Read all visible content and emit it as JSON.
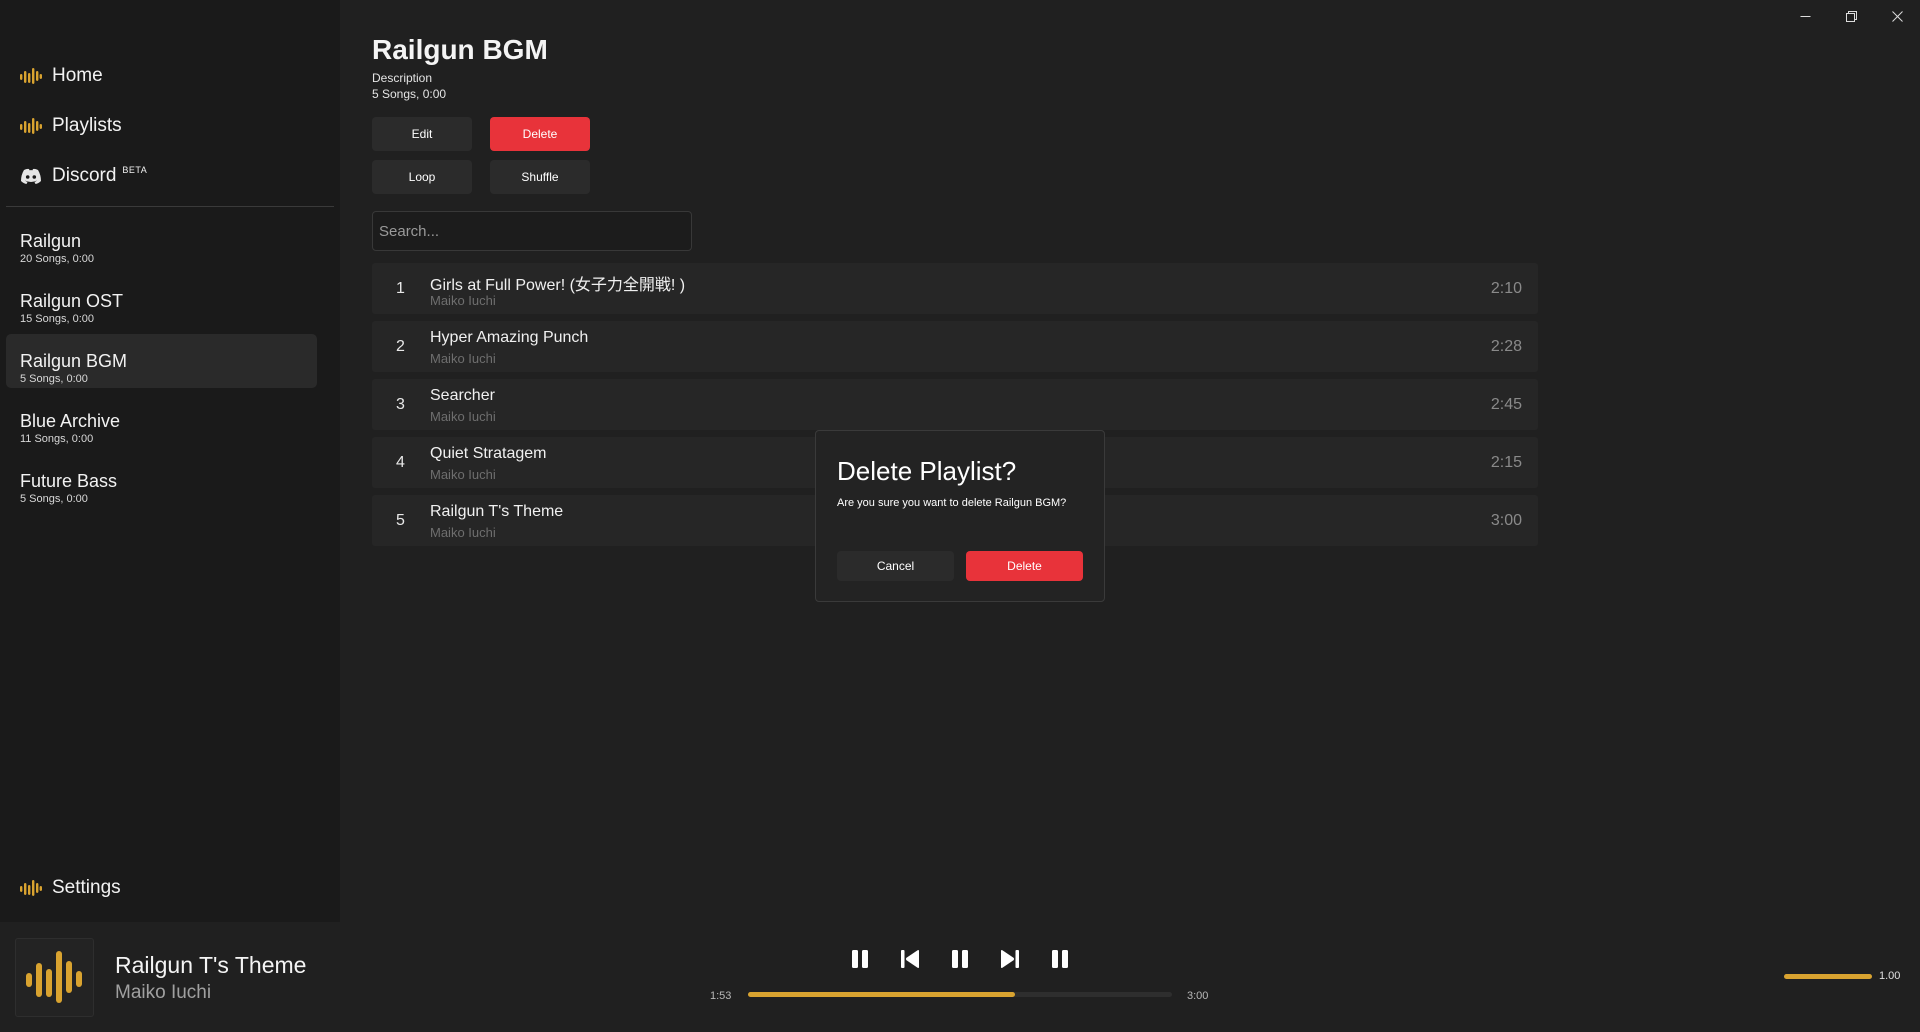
{
  "colors": {
    "accent": "#d9a330",
    "danger": "#e8333a",
    "background": "#202020",
    "sidebar": "#1a1a1a"
  },
  "window": {
    "controls": [
      "minimize-icon",
      "restore-icon",
      "close-icon"
    ]
  },
  "sidebar": {
    "nav": [
      {
        "label": "Home",
        "icon": "waveform-icon"
      },
      {
        "label": "Playlists",
        "icon": "waveform-icon"
      },
      {
        "label": "Discord",
        "badge": "BETA",
        "icon": "discord-icon"
      }
    ],
    "playlists": [
      {
        "name": "Railgun",
        "meta": "20 Songs, 0:00"
      },
      {
        "name": "Railgun OST",
        "meta": "15 Songs, 0:00"
      },
      {
        "name": "Railgun BGM",
        "meta": "5 Songs, 0:00",
        "active": true
      },
      {
        "name": "Blue Archive",
        "meta": "11 Songs, 0:00"
      },
      {
        "name": "Future Bass",
        "meta": "5 Songs, 0:00"
      }
    ],
    "settings": {
      "label": "Settings",
      "icon": "waveform-icon"
    }
  },
  "playlist": {
    "title": "Railgun BGM",
    "description": "Description",
    "meta": "5 Songs, 0:00",
    "buttons": {
      "edit": "Edit",
      "delete": "Delete",
      "loop": "Loop",
      "shuffle": "Shuffle"
    },
    "search_placeholder": "Search..."
  },
  "songs": [
    {
      "num": "1",
      "title": "Girls at Full Power! (女子力全開戦! )",
      "artist": "Maiko Iuchi",
      "duration": "2:10"
    },
    {
      "num": "2",
      "title": "Hyper Amazing Punch",
      "artist": "Maiko Iuchi",
      "duration": "2:28"
    },
    {
      "num": "3",
      "title": "Searcher",
      "artist": "Maiko Iuchi",
      "duration": "2:45"
    },
    {
      "num": "4",
      "title": "Quiet Stratagem",
      "artist": "Maiko Iuchi",
      "duration": "2:15"
    },
    {
      "num": "5",
      "title": "Railgun T's Theme",
      "artist": "Maiko Iuchi",
      "duration": "3:00"
    }
  ],
  "dialog": {
    "title": "Delete Playlist?",
    "message": "Are you sure you want to delete Railgun BGM?",
    "cancel": "Cancel",
    "confirm": "Delete"
  },
  "player": {
    "title": "Railgun T's Theme",
    "artist": "Maiko Iuchi",
    "elapsed": "1:53",
    "total": "3:00",
    "progress": 0.63,
    "volume": 1.0,
    "volume_label": "1.00",
    "controls": [
      "pause-icon",
      "skip-previous-icon",
      "pause-icon",
      "skip-next-icon",
      "pause-icon"
    ]
  }
}
